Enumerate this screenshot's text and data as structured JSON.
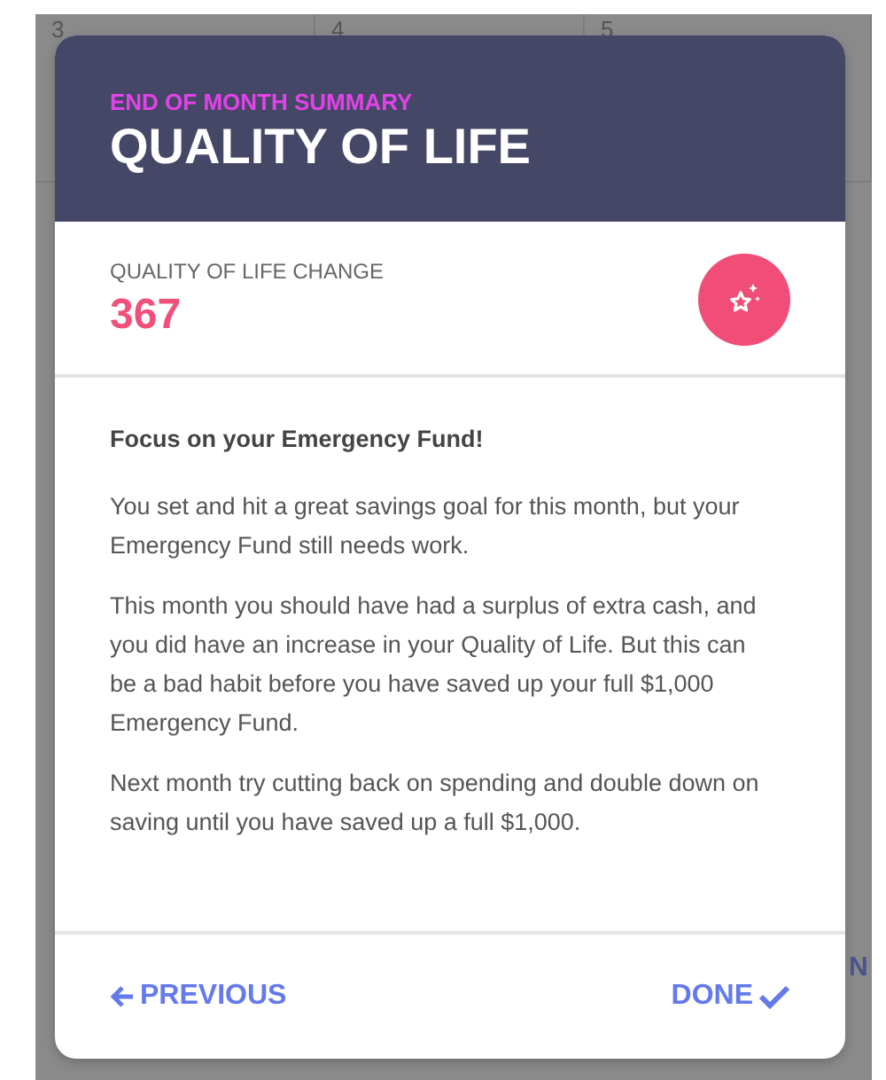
{
  "backdrop": {
    "day_numbers": [
      "3",
      "4",
      "5"
    ],
    "tab_fragment": "N"
  },
  "modal": {
    "eyebrow": "END OF MONTH SUMMARY",
    "title": "QUALITY OF LIFE",
    "stat": {
      "label": "QUALITY OF LIFE CHANGE",
      "value": "367"
    },
    "heading": "Focus on your Emergency Fund!",
    "paragraphs": [
      "You set and hit a great savings goal for this month, but your Emergency Fund still needs work.",
      "This month you should have had a surplus of extra cash, and you did have an increase in your Quality of Life. But this can be a bad habit before you have saved up your full $1,000 Emergency Fund.",
      "Next month try cutting back on spending and double down on saving until you have saved up a full $1,000."
    ],
    "actions": [
      {
        "label": "PREVIOUS",
        "kind": "back"
      },
      {
        "label": "DONE",
        "kind": "done"
      }
    ]
  }
}
